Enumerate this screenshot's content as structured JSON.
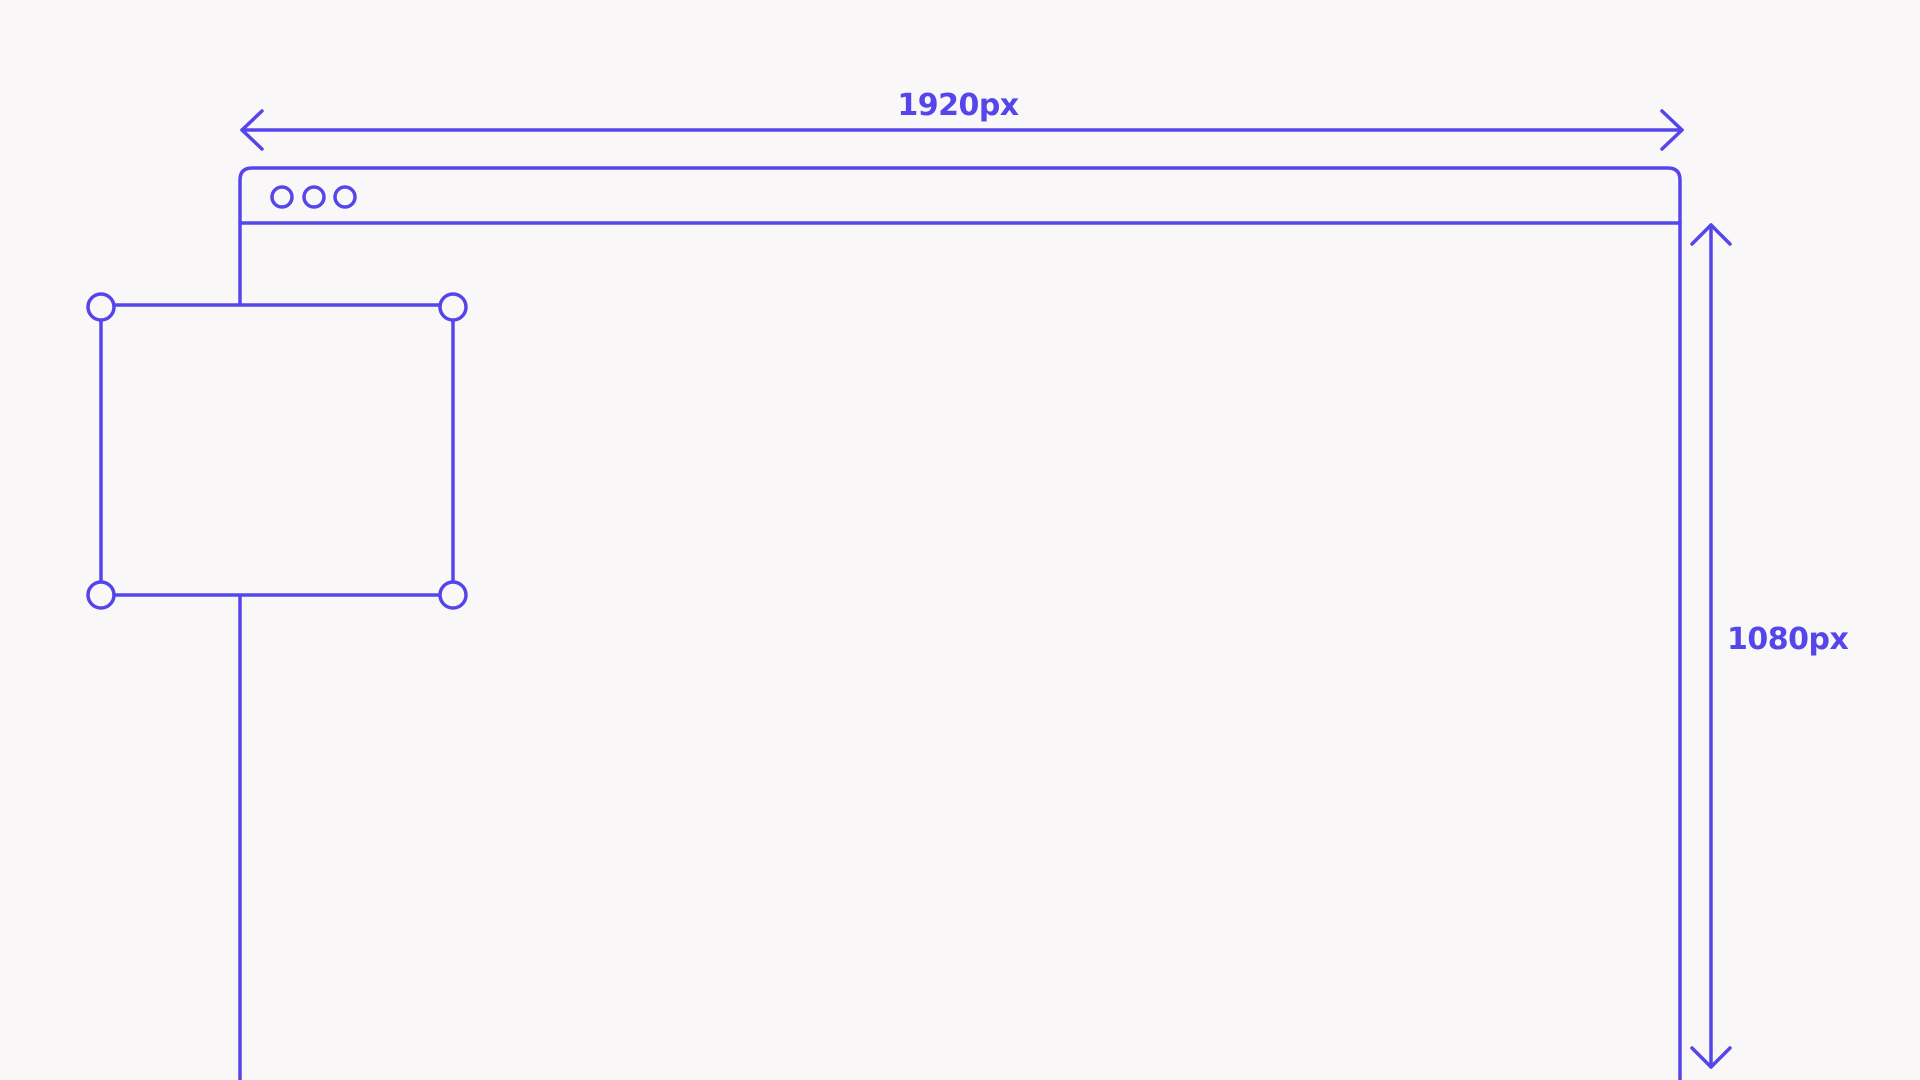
{
  "colors": {
    "background": "#f9f7f8",
    "accent": "#5546ea"
  },
  "dimensions": {
    "width_label": "1920px",
    "height_label": "1080px"
  },
  "window": {
    "traffic_light_count": 3
  },
  "selection": {
    "handle_count": 4
  }
}
